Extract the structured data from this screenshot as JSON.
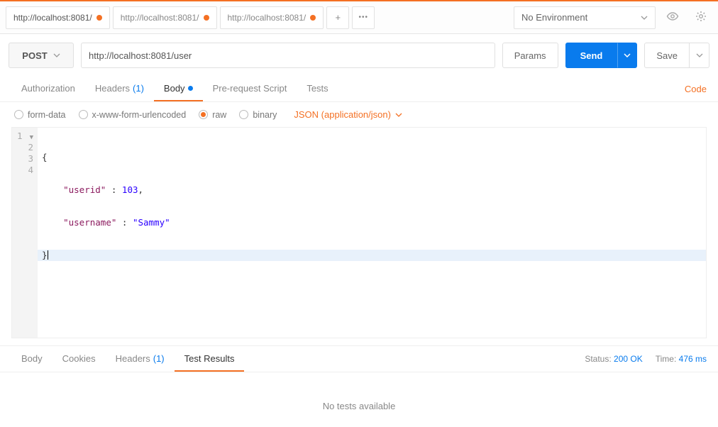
{
  "tabs": [
    {
      "label": "http://localhost:8081/",
      "active": true,
      "dirty": true
    },
    {
      "label": "http://localhost:8081/",
      "active": false,
      "dirty": true
    },
    {
      "label": "http://localhost:8081/",
      "active": false,
      "dirty": true
    }
  ],
  "environment": {
    "selected": "No Environment"
  },
  "request": {
    "method": "POST",
    "url": "http://localhost:8081/user",
    "params_label": "Params",
    "send_label": "Send",
    "save_label": "Save"
  },
  "req_tabs": {
    "authorization": "Authorization",
    "headers": "Headers",
    "headers_count": "(1)",
    "body": "Body",
    "prerequest": "Pre-request Script",
    "tests": "Tests",
    "code": "Code"
  },
  "body_options": {
    "formdata": "form-data",
    "urlencoded": "x-www-form-urlencoded",
    "raw": "raw",
    "binary": "binary",
    "content_type": "JSON (application/json)"
  },
  "editor": {
    "lines": [
      "1",
      "2",
      "3",
      "4"
    ],
    "json_body": {
      "userid": 103,
      "username": "Sammy"
    },
    "key1": "\"userid\"",
    "val1": "103",
    "key2": "\"username\"",
    "val2": "\"Sammy\""
  },
  "response_tabs": {
    "body": "Body",
    "cookies": "Cookies",
    "headers": "Headers",
    "headers_count": "(1)",
    "tests": "Test Results"
  },
  "status": {
    "status_label": "Status:",
    "status_value": "200 OK",
    "time_label": "Time:",
    "time_value": "476 ms"
  },
  "response_body": {
    "empty_tests": "No tests available"
  },
  "icons": {
    "plus": "+",
    "more": "•••"
  }
}
